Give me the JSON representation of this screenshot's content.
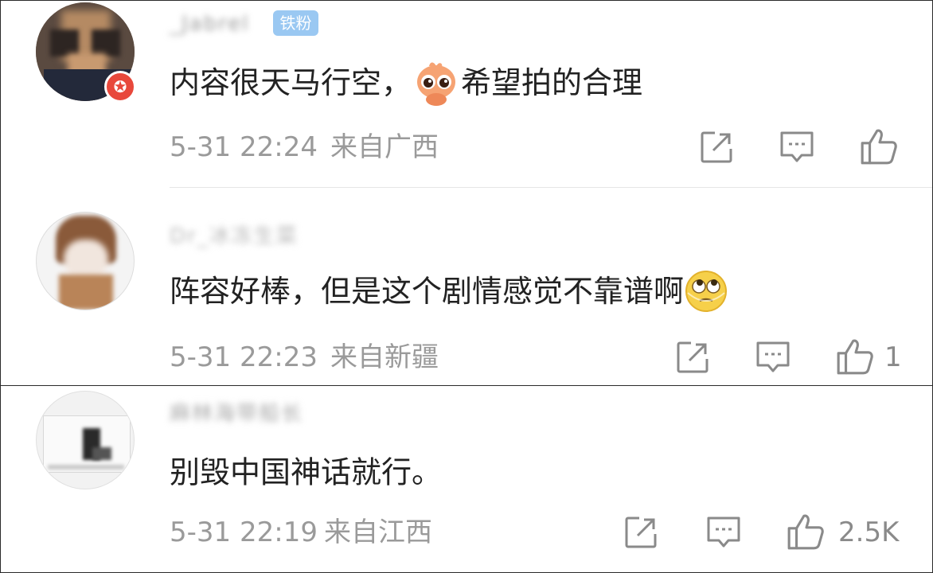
{
  "comments": [
    {
      "username": "_Jabrel",
      "badge": "铁粉",
      "text_before_emoji": "内容很天马行空，",
      "text_after_emoji": "希望拍的合理",
      "emoji": "pleading-emoji",
      "time": "5-31 22:24",
      "location": "来自广西",
      "like_count": ""
    },
    {
      "username": "Dr_冰冻生菜",
      "badge": "",
      "text_before_emoji": "阵容好棒，但是这个剧情感觉不靠谱啊",
      "text_after_emoji": "",
      "emoji": "eye-roll-emoji",
      "time": "5-31 22:23",
      "location": "来自新疆",
      "like_count": "1"
    },
    {
      "username": "麻林海带船长",
      "badge": "",
      "text_before_emoji": "别毁中国神话就行。",
      "text_after_emoji": "",
      "emoji": "",
      "time": "5-31 22:19",
      "location": "来自江西",
      "like_count": "2.5K"
    }
  ],
  "icons": {
    "share": "share-icon",
    "comment": "comment-icon",
    "like": "like-icon",
    "verified": "verified-badge-icon"
  },
  "colors": {
    "text": "#222222",
    "meta": "#9a9a9a",
    "fan_badge": "#9ac8f2",
    "verified": "#e8483b"
  }
}
